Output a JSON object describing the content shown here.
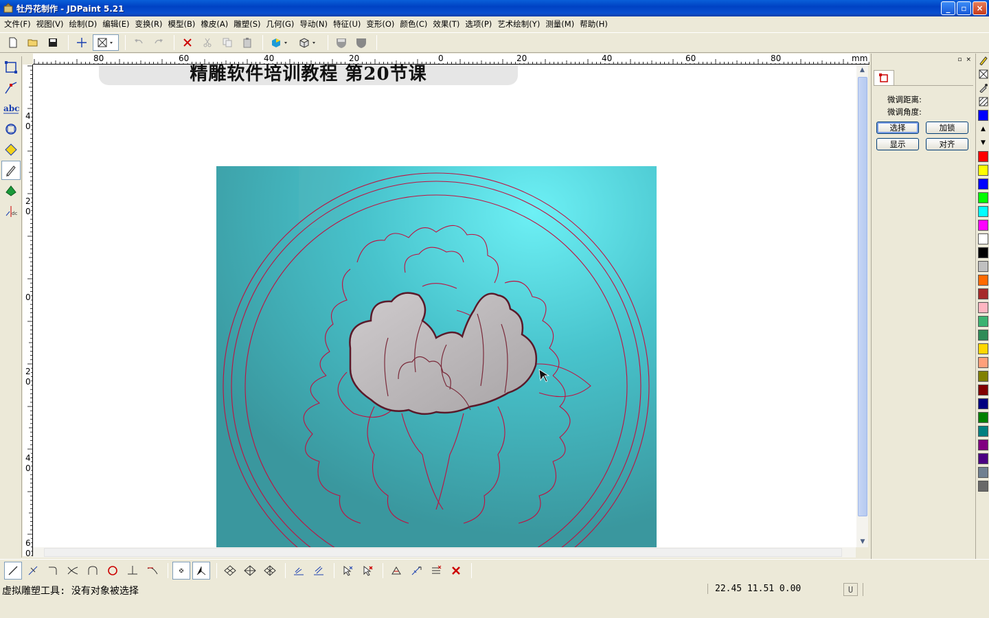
{
  "window": {
    "title": "牡丹花制作 - JDPaint 5.21",
    "min_glyph": "_",
    "max_glyph": "▫",
    "close_glyph": "×"
  },
  "menu": [
    {
      "label": "文件(F)"
    },
    {
      "label": "视图(V)"
    },
    {
      "label": "绘制(D)"
    },
    {
      "label": "编辑(E)"
    },
    {
      "label": "变换(R)"
    },
    {
      "label": "模型(B)"
    },
    {
      "label": "橡皮(A)"
    },
    {
      "label": "雕塑(S)"
    },
    {
      "label": "几何(G)"
    },
    {
      "label": "导动(N)"
    },
    {
      "label": "特征(U)"
    },
    {
      "label": "变形(O)"
    },
    {
      "label": "颜色(C)"
    },
    {
      "label": "效果(T)"
    },
    {
      "label": "选项(P)"
    },
    {
      "label": "艺术绘制(Y)"
    },
    {
      "label": "测量(M)"
    },
    {
      "label": "帮助(H)"
    }
  ],
  "ruler": {
    "unit": "mm",
    "h_labels": [
      "80",
      "60",
      "40",
      "20",
      "0",
      "20",
      "40",
      "60",
      "80"
    ],
    "v_labels": [
      "40",
      "20",
      "0",
      "20",
      "40",
      "60"
    ]
  },
  "canvas": {
    "banner_text": "精雕软件培训教程  第20节课"
  },
  "panel": {
    "fine_distance_label": "微调距离:",
    "fine_angle_label": "微调角度:",
    "select_button": "选择",
    "lock_button": "加锁",
    "display_button": "显示",
    "align_button": "对齐"
  },
  "palette": {
    "colors": [
      "#ff0000",
      "#ffff00",
      "#0000ff",
      "#00ff00",
      "#00ffff",
      "#ff00ff",
      "#ffffff",
      "#000000",
      "#c0c0c0",
      "#ff6a00",
      "#a52a2a",
      "#ffb6c1",
      "#3cb371",
      "#2e8b57",
      "#ffd700",
      "#ffa07a",
      "#808000",
      "#800000",
      "#000080",
      "#008000",
      "#008080",
      "#800080",
      "#4b0082",
      "#708090",
      "#696969"
    ],
    "top_color": "#0000ff"
  },
  "status": {
    "message": "虚拟雕塑工具: 没有对象被选择",
    "coords": "22.45 11.51  0.00",
    "u_label": "U"
  },
  "art_colors": {
    "teal": "#3da3a8",
    "cyan_highlight": "#6df0f5",
    "outline": "#c01040",
    "petal_fill": "#b8b4b6"
  }
}
